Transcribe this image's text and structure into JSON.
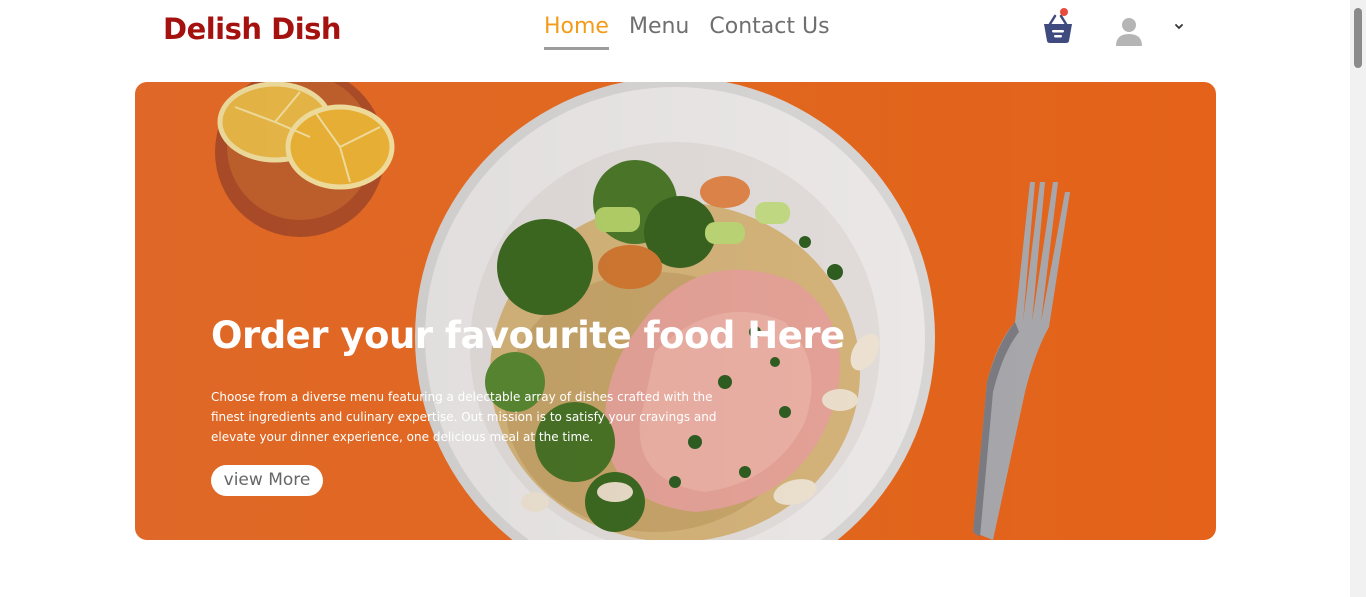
{
  "header": {
    "logo": "Delish Dish",
    "nav": [
      {
        "label": "Home",
        "active": true
      },
      {
        "label": "Menu",
        "active": false
      },
      {
        "label": "Contact Us",
        "active": false
      }
    ],
    "icons": {
      "cart": "basket-icon",
      "user": "user-avatar-icon",
      "dropdown": "chevron-down-icon"
    }
  },
  "hero": {
    "title": "Order your favourite food Here",
    "description": "Choose from a diverse menu featuring a delectable array of dishes crafted with the finest ingredients and culinary expertise. Out mission is to satisfy your cravings and elevate your dinner experience, one delicious meal at the time.",
    "button_label": "view More"
  },
  "colors": {
    "brand": "#a4110f",
    "nav_active": "#f39c1b",
    "hero_bg": "#ec6d22",
    "cart_icon": "#3f4b7f",
    "notification_dot": "#e74c3c"
  }
}
